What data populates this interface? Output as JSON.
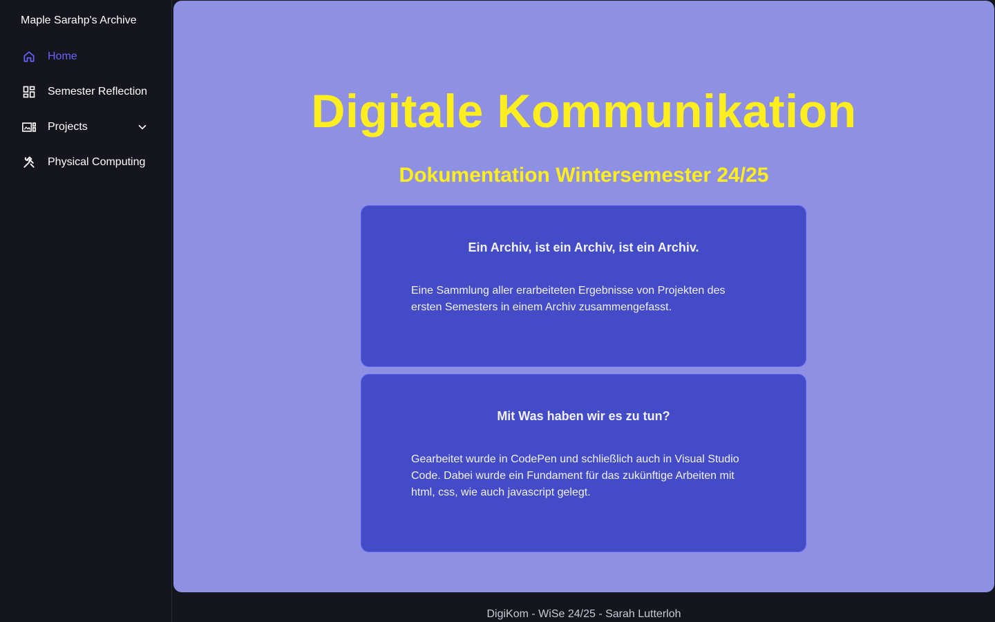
{
  "sidebar": {
    "brand": "Maple Sarahp's Archive",
    "items": [
      {
        "label": "Home",
        "icon": "home-icon",
        "active": true
      },
      {
        "label": "Semester Reflection",
        "icon": "dashboard-icon"
      },
      {
        "label": "Projects",
        "icon": "image-card-icon",
        "has_submenu": true
      },
      {
        "label": "Physical Computing",
        "icon": "tools-icon"
      }
    ]
  },
  "main": {
    "title": "Digitale Kommunikation",
    "subtitle": "Dokumentation Wintersemester 24/25",
    "cards": [
      {
        "heading": "Ein Archiv, ist ein Archiv, ist ein Archiv.",
        "text": "Eine Sammlung aller erarbeiteten Ergebnisse von Projekten des ersten Semesters in einem Archiv zusammengefasst."
      },
      {
        "heading": "Mit Was haben wir es zu tun?",
        "text": "Gearbeitet wurde in CodePen und schließlich auch in Visual Studio Code. Dabei wurde ein Fundament für das zukünftige Arbeiten mit html, css, wie auch javascript gelegt."
      }
    ]
  },
  "footer": {
    "text": "DigiKom - WiSe 24/25 - Sarah Lutterloh"
  },
  "colors": {
    "accent": "#6b63ff",
    "title_yellow": "#ffee1f",
    "main_bg": "#8e91e3",
    "card_bg": "#444bc6",
    "sidebar_bg": "#15151d"
  }
}
